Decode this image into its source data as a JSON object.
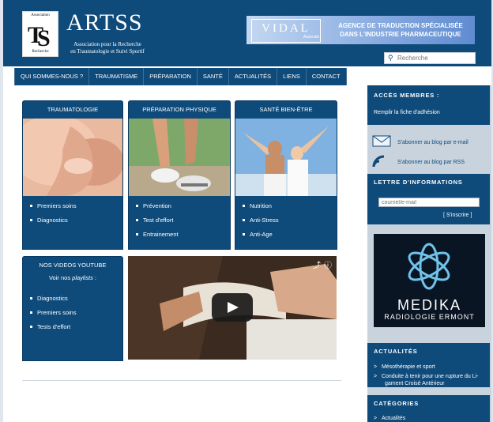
{
  "brand": {
    "logo_top": "Association",
    "logo_bottom": "Recherche",
    "title": "ARTSS",
    "subtitle_1": "Association pour la Recherche",
    "subtitle_2": "en Traumatologie et Suivi Sportif"
  },
  "banner": {
    "vidal": "VIDAL",
    "associes": "Associés",
    "line1": "AGENCE DE TRADUCTION SPÉCIALISÉE",
    "line2": "DANS L'INDUSTRIE PHARMACEUTIQUE"
  },
  "search": {
    "placeholder": "Recherche"
  },
  "nav": [
    "QUI SOMMES-NOUS ?",
    "TRAUMATISME",
    "PRÉPARATION",
    "SANTÉ",
    "ACTUALITÉS",
    "LIENS",
    "CONTACT"
  ],
  "boxes": [
    {
      "title": "TRAUMATOLOGIE",
      "items": [
        "Premiers soins",
        "Diagnostics"
      ]
    },
    {
      "title": "PRÉPARATION PHYSIQUE",
      "items": [
        "Prévention",
        "Test d'effort",
        "Entrainement"
      ]
    },
    {
      "title": "SANTÉ BIEN-ÊTRE",
      "items": [
        "Nutrition",
        "Anti-Stress",
        "Anti-Age"
      ]
    }
  ],
  "youtube": {
    "title": "NOS VIDEOS YOUTUBE",
    "sub_prefix": "Voir nos ",
    "sub_em": "playlists",
    "sub_suffix": " :",
    "items": [
      "Diagnostics",
      "Premiers soins",
      "Tests d'effort"
    ]
  },
  "sidebar": {
    "members_title": "ACCÈS MEMBRES :",
    "members_link": "Remplir la fiche d'adhésion",
    "subscribe_email": "S'abonner au blog par e-mail",
    "subscribe_rss": "S'abonner au blog par RSS",
    "newsletter_title": "LETTRE D'INFORMATIONS",
    "email_placeholder": "courriel/e-mail",
    "subscribe_button": "[ S'inscrire ]",
    "medika_1": "MEDIKA",
    "medika_2": "RADIOLOGIE ERMONT",
    "news_title": "ACTUALITÉS",
    "news": [
      "Mésothérapie et sport",
      "Conduite à tenir pour une rupture du Li-",
      "gament Croisé Antérieur"
    ],
    "cats_title": "CATÉGORIES",
    "cats": [
      "Actualités"
    ]
  },
  "colors": {
    "primary": "#0e4a7a",
    "sidebar_bg": "#c9d3de"
  }
}
